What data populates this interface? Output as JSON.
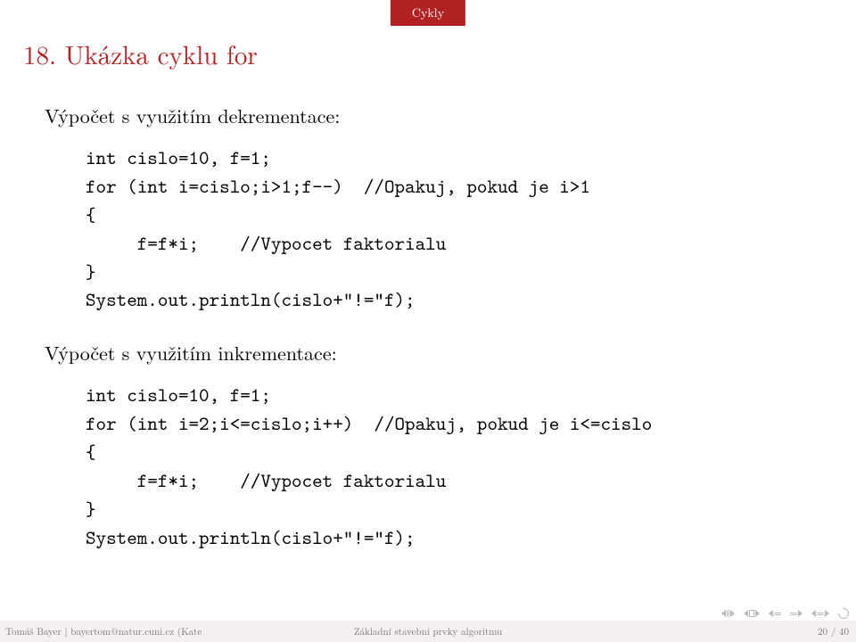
{
  "header": {
    "section": "Cykly"
  },
  "title": "18. Ukázka cyklu for",
  "subtitle1": "Výpočet s využitím dekrementace:",
  "code1": "int cislo=10, f=1;\nfor (int i=cislo;i>1;f--)  //Opakuj, pokud je i>1\n{\n     f=f*i;    //Vypocet faktorialu\n}\nSystem.out.println(cislo+\"!=\"f);",
  "subtitle2": "Výpočet s využitím inkrementace:",
  "code2": "int cislo=10, f=1;\nfor (int i=2;i<=cislo;i++)  //Opakuj, pokud je i<=cislo\n{\n     f=f*i;    //Vypocet faktorialu\n}\nSystem.out.println(cislo+\"!=\"f);",
  "footer": {
    "author": "Tomáš Bayer | bayertom@natur.cuni.cz (Kate",
    "center": "Základní stavební prvky algoritmu",
    "page": "20 / 40"
  }
}
